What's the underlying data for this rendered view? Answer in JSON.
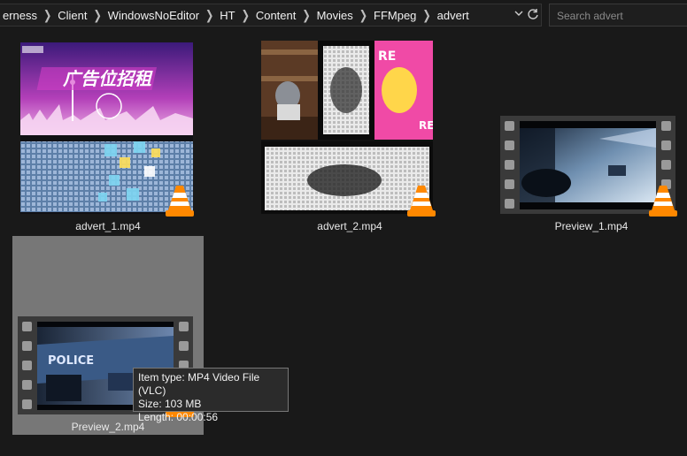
{
  "address_bar": {
    "crumbs": [
      "erness",
      "Client",
      "WindowsNoEditor",
      "HT",
      "Content",
      "Movies",
      "FFMpeg",
      "advert"
    ],
    "dropdown_icon": "chevron-down-icon",
    "refresh_icon": "refresh-icon"
  },
  "search": {
    "placeholder": "Search advert"
  },
  "files": [
    {
      "name": "advert_1.mp4",
      "overlay_icon": "vlc-cone-icon"
    },
    {
      "name": "advert_2.mp4",
      "overlay_icon": "vlc-cone-icon"
    },
    {
      "name": "Preview_1.mp4",
      "overlay_icon": "vlc-cone-icon"
    },
    {
      "name": "Preview_2.mp4",
      "overlay_icon": "vlc-cone-icon"
    }
  ],
  "thumbnails": {
    "advert_1_banner": "广告位招租",
    "preview_2_sign": "POLICE"
  },
  "tooltip": {
    "type": "Item type: MP4 Video File (VLC)",
    "size": "Size: 103 MB",
    "length": "Length: 00:00:56"
  },
  "colors": {
    "background": "#191919",
    "selected": "#777777",
    "vlc_orange": "#ff8800"
  }
}
